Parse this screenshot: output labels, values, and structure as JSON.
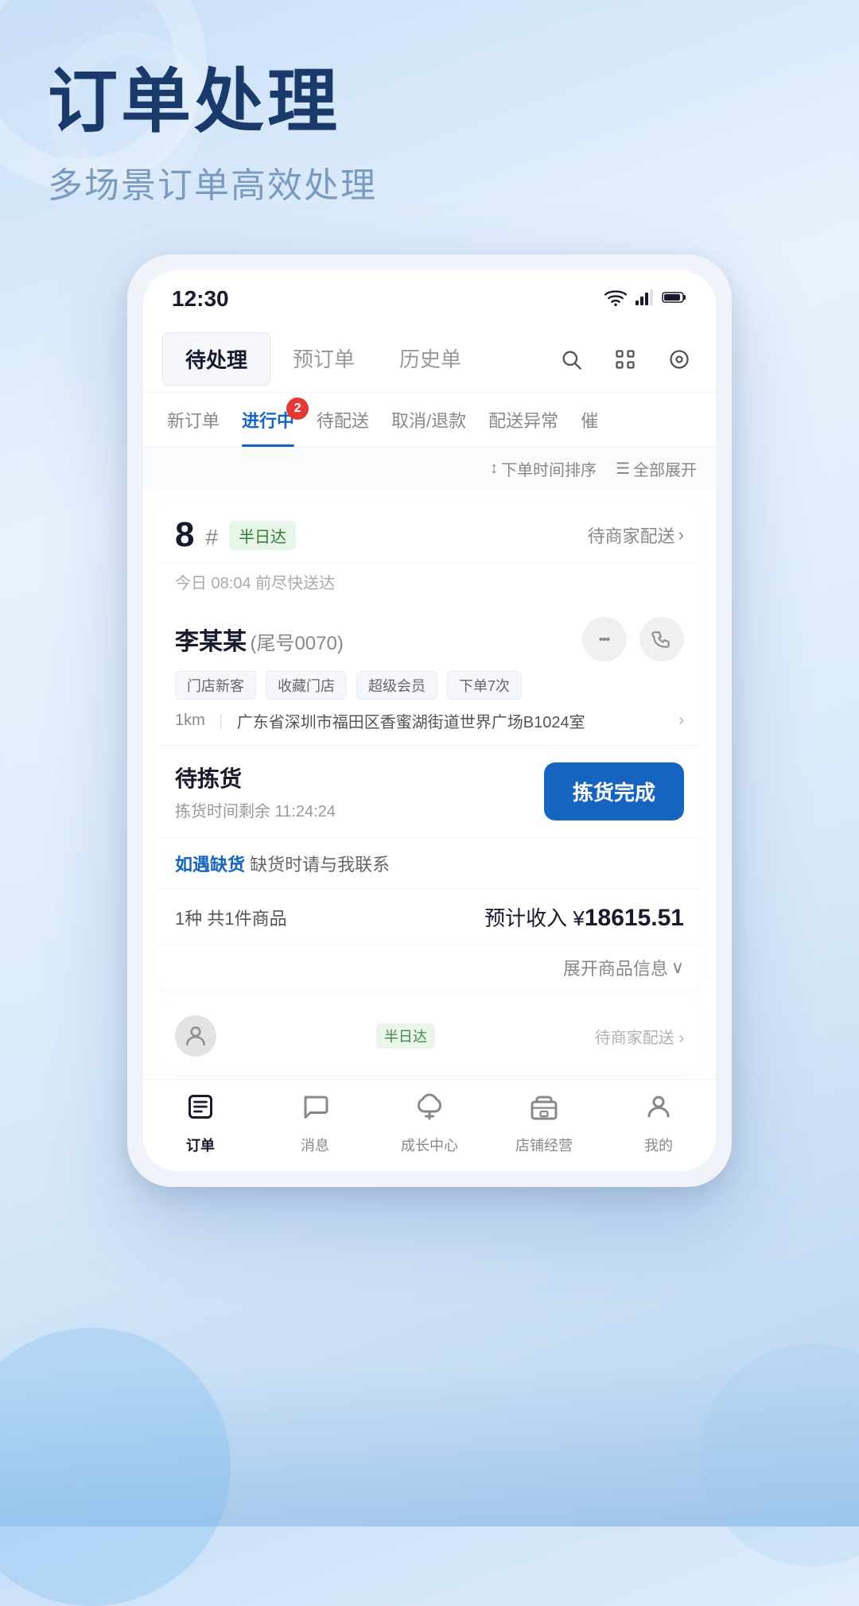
{
  "background": {
    "gradient": "linear-gradient(160deg, #c8dff8 0%, #e8f2fd 30%, #daeafa 60%, #b8d4f0 100%)"
  },
  "header": {
    "title": "订单处理",
    "subtitle": "多场景订单高效处理"
  },
  "phone": {
    "status_bar": {
      "time": "12:30"
    },
    "top_tabs": [
      {
        "label": "待处理",
        "active": true
      },
      {
        "label": "预订单",
        "active": false
      },
      {
        "label": "历史单",
        "active": false
      }
    ],
    "sub_tabs": [
      {
        "label": "新订单",
        "active": false
      },
      {
        "label": "进行中",
        "active": true,
        "badge": "2"
      },
      {
        "label": "待配送",
        "active": false
      },
      {
        "label": "取消/退款",
        "active": false
      },
      {
        "label": "配送异常",
        "active": false
      },
      {
        "label": "催",
        "active": false
      }
    ],
    "sort_options": {
      "time_sort": "下单时间排序",
      "expand_all": "全部展开"
    },
    "order_card": {
      "number": "8",
      "hash": "#",
      "tag": "半日达",
      "status": "待商家配送",
      "delivery_time": "今日 08:04 前尽快送达",
      "customer": {
        "name": "李某某",
        "id": "(尾号0070)",
        "tags": [
          "门店新客",
          "收藏门店",
          "超级会员",
          "下单7次"
        ],
        "distance": "1km",
        "address": "广东省深圳市福田区香蜜湖街道世界广场B1024室"
      },
      "picking": {
        "label": "待拣货",
        "timer_prefix": "拣货时间剩余",
        "timer": "11:24:24",
        "button": "拣货完成"
      },
      "oos": {
        "link_text": "如遇缺货",
        "notice_text": "缺货时请与我联系"
      },
      "summary": {
        "left": "1种 共1件商品",
        "income_label": "预计收入 ¥",
        "income_amount": "18615.51"
      },
      "expand": "展开商品信息"
    },
    "bottom_nav": [
      {
        "label": "订单",
        "active": true,
        "icon": "📋"
      },
      {
        "label": "消息",
        "active": false,
        "icon": "💬"
      },
      {
        "label": "成长中心",
        "active": false,
        "icon": "🌿"
      },
      {
        "label": "店铺经营",
        "active": false,
        "icon": "📊"
      },
      {
        "label": "我的",
        "active": false,
        "icon": "👤"
      }
    ]
  }
}
